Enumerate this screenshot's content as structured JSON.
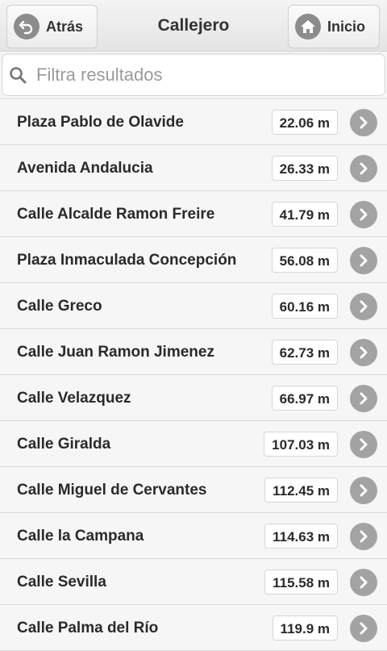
{
  "header": {
    "back_label": "Atrás",
    "title": "Callejero",
    "home_label": "Inicio"
  },
  "search": {
    "placeholder": "Filtra resultados",
    "value": ""
  },
  "results": [
    {
      "name": "Plaza Pablo de Olavide",
      "distance": "22.06 m"
    },
    {
      "name": "Avenida Andalucia",
      "distance": "26.33 m"
    },
    {
      "name": "Calle Alcalde Ramon Freire",
      "distance": "41.79 m"
    },
    {
      "name": "Plaza Inmaculada Concepción",
      "distance": "56.08 m"
    },
    {
      "name": "Calle Greco",
      "distance": "60.16 m"
    },
    {
      "name": "Calle Juan Ramon Jimenez",
      "distance": "62.73 m"
    },
    {
      "name": "Calle Velazquez",
      "distance": "66.97 m"
    },
    {
      "name": "Calle Giralda",
      "distance": "107.03 m"
    },
    {
      "name": "Calle Miguel de Cervantes",
      "distance": "112.45 m"
    },
    {
      "name": "Calle la Campana",
      "distance": "114.63 m"
    },
    {
      "name": "Calle Sevilla",
      "distance": "115.58 m"
    },
    {
      "name": "Calle Palma del Río",
      "distance": "119.9 m"
    }
  ],
  "icons": {
    "back": "back-arrow-icon",
    "home": "home-icon",
    "search": "search-icon",
    "row": "chevron-right-icon"
  },
  "colors": {
    "icon_gray": "#8c8c8c",
    "chevron_gray": "#a3a3a3",
    "background": "#f6f6f6"
  }
}
